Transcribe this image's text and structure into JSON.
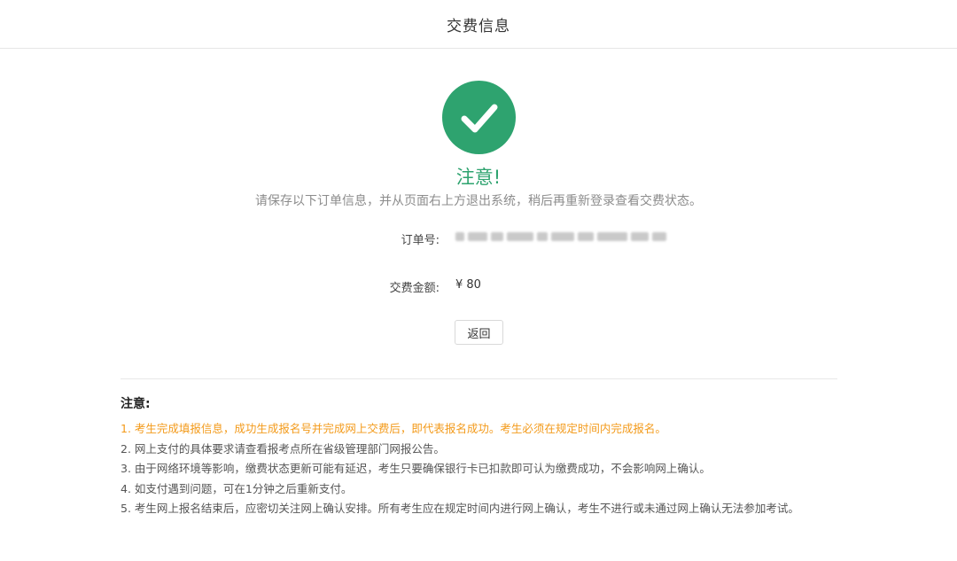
{
  "header": {
    "title": "交费信息"
  },
  "result": {
    "title": "注意!",
    "subtitle": "请保存以下订单信息，并从页面右上方退出系统，稍后再重新登录查看交费状态。"
  },
  "order": {
    "number_label": "订单号:",
    "amount_label": "交费金额:",
    "amount_value": "¥ 80"
  },
  "actions": {
    "back_label": "返回"
  },
  "notes": {
    "title": "注意:",
    "items": [
      "1. 考生完成填报信息，成功生成报名号并完成网上交费后，即代表报名成功。考生必须在规定时间内完成报名。",
      "2. 网上支付的具体要求请查看报考点所在省级管理部门网报公告。",
      "3. 由于网络环境等影响，缴费状态更新可能有延迟，考生只要确保银行卡已扣款即可认为缴费成功，不会影响网上确认。",
      "4. 如支付遇到问题，可在1分钟之后重新支付。",
      "5. 考生网上报名结束后，应密切关注网上确认安排。所有考生应在规定时间内进行网上确认，考生不进行或未通过网上确认无法参加考试。"
    ]
  },
  "colors": {
    "success": "#2ea36f",
    "warning": "#f39a1a"
  },
  "icons": {
    "status": "check-circle-icon"
  }
}
